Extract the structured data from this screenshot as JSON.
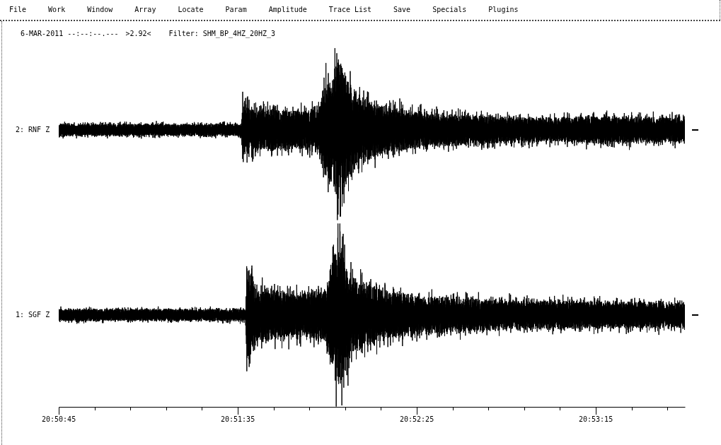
{
  "menu": [
    "File",
    "Work",
    "Window",
    "Array",
    "Locate",
    "Param",
    "Amplitude",
    "Trace List",
    "Save",
    "Specials",
    "Plugins"
  ],
  "header": {
    "date_time": "6-MAR-2011 --:--:--.---",
    "ratio": ">2.92<",
    "filter": "Filter: SHM_BP_4HZ_20HZ_3"
  },
  "traces": [
    {
      "label": "2: RNF Z"
    },
    {
      "label": "1: SGF Z"
    }
  ],
  "time_axis": {
    "labels": [
      "20:50:45",
      "20:51:35",
      "20:52:25",
      "20:53:15"
    ]
  }
}
